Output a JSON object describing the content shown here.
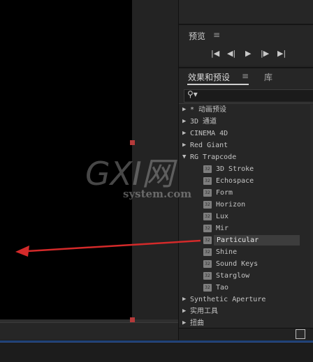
{
  "preview": {
    "title": "预览",
    "menu_icon": "≡",
    "controls": [
      "first-frame-icon",
      "prev-frame-icon",
      "play-icon",
      "next-frame-icon",
      "last-frame-icon"
    ],
    "control_glyphs": {
      "first": "|◀",
      "prev": "◀|",
      "play": "▶",
      "next": "|▶",
      "last": "▶|"
    }
  },
  "effects": {
    "tab_label": "效果和预设",
    "tab_menu_icon": "≡",
    "library_tab": "库",
    "search_icon_glyph": "⚲▾",
    "tree": [
      {
        "type": "category",
        "label": "* 动画预设",
        "expanded": false
      },
      {
        "type": "category",
        "label": "3D 通道",
        "expanded": false
      },
      {
        "type": "category",
        "label": "CINEMA 4D",
        "expanded": false
      },
      {
        "type": "category",
        "label": "Red Giant",
        "expanded": false
      },
      {
        "type": "category",
        "label": "RG Trapcode",
        "expanded": true
      },
      {
        "type": "effect",
        "label": "3D Stroke"
      },
      {
        "type": "effect",
        "label": "Echospace"
      },
      {
        "type": "effect",
        "label": "Form"
      },
      {
        "type": "effect",
        "label": "Horizon"
      },
      {
        "type": "effect",
        "label": "Lux"
      },
      {
        "type": "effect",
        "label": "Mir"
      },
      {
        "type": "effect",
        "label": "Particular",
        "selected": true
      },
      {
        "type": "effect",
        "label": "Shine"
      },
      {
        "type": "effect",
        "label": "Sound Keys"
      },
      {
        "type": "effect",
        "label": "Starglow"
      },
      {
        "type": "effect",
        "label": "Tao"
      },
      {
        "type": "category",
        "label": "Synthetic Aperture",
        "expanded": false
      },
      {
        "type": "category",
        "label": "实用工具",
        "expanded": false
      },
      {
        "type": "category",
        "label": "扭曲",
        "expanded": false
      }
    ],
    "expand_glyph": "▶",
    "collapse_glyph": "▼"
  },
  "watermark": {
    "big": "GXI网",
    "small": "system.com"
  },
  "colors": {
    "annotation_arrow": "#d42a2a",
    "handle": "#b53a3a",
    "selection": "#3d3d3d"
  }
}
